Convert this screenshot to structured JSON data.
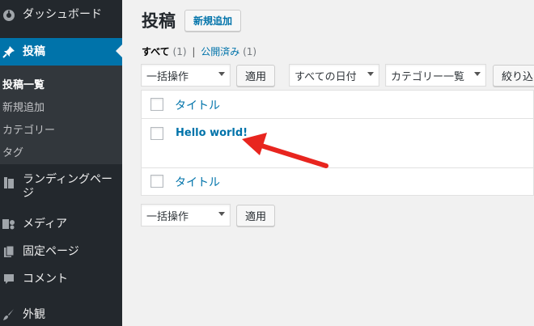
{
  "sidebar": {
    "items": [
      {
        "label": "ダッシュボード",
        "icon": "dashboard-icon"
      },
      {
        "label": "投稿",
        "icon": "pin-icon",
        "active": true
      },
      {
        "label": "ランディングページ",
        "icon": "landing-icon"
      },
      {
        "label": "メディア",
        "icon": "media-icon"
      },
      {
        "label": "固定ページ",
        "icon": "page-icon"
      },
      {
        "label": "コメント",
        "icon": "comment-icon"
      },
      {
        "label": "外観",
        "icon": "brush-icon"
      }
    ],
    "submenu": [
      "投稿一覧",
      "新規追加",
      "カテゴリー",
      "タグ"
    ]
  },
  "header": {
    "title": "投稿",
    "add_new": "新規追加"
  },
  "filters": {
    "all_label": "すべて",
    "all_count": "(1)",
    "separator": "|",
    "published_label": "公開済み",
    "published_count": "(1)"
  },
  "toolbar": {
    "bulk_action": "一括操作",
    "apply": "適用",
    "dates": "すべての日付",
    "categories": "カテゴリー一覧",
    "filter": "絞り込"
  },
  "table": {
    "column_title": "タイトル",
    "rows": [
      {
        "title": "Hello world!"
      }
    ]
  },
  "colors": {
    "sidebar_bg": "#23282d",
    "active_bg": "#0073aa",
    "link": "#0073aa",
    "arrow": "#e8251f"
  }
}
